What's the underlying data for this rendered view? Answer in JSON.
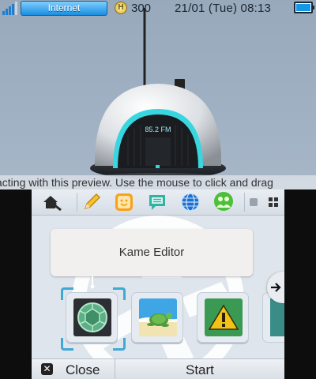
{
  "status_bar": {
    "internet_label": "Internet",
    "coins": "300",
    "coin_symbol": "H",
    "datetime": "21/01 (Tue) 08:13",
    "signal_icon": "signal-bars-icon",
    "battery_icon": "battery-icon"
  },
  "top_screen": {
    "radio_display": "85.2 FM",
    "scene": "dome-radio-3d-preview"
  },
  "banner": {
    "text": "acting with this preview. Use the mouse to click and drag"
  },
  "toolbar": {
    "items": [
      {
        "name": "settings",
        "icon": "house-wrench-icon"
      },
      {
        "name": "notes",
        "icon": "pencil-icon"
      },
      {
        "name": "miiverse",
        "icon": "smiley-face-icon"
      },
      {
        "name": "notifications",
        "icon": "speech-bubble-icon"
      },
      {
        "name": "browser",
        "icon": "globe-icon"
      },
      {
        "name": "friends",
        "icon": "friends-icon"
      }
    ]
  },
  "selected_app": {
    "title": "Kame Editor"
  },
  "apps": [
    {
      "name": "kame-editor",
      "icon": "turtle-shell-icon",
      "selected": true
    },
    {
      "name": "turtle-beach-app",
      "icon": "sea-turtle-icon",
      "selected": false
    },
    {
      "name": "warning-app",
      "icon": "warning-icon",
      "selected": false
    }
  ],
  "bottom_bar": {
    "close_label": "Close",
    "close_button_glyph": "✕",
    "start_label": "Start"
  },
  "colors": {
    "accent_blue": "#1a8de0",
    "selection": "#3fa9d6",
    "radio_glow": "#38d7e0"
  }
}
